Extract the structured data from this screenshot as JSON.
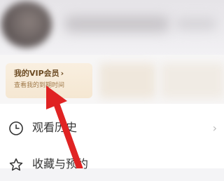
{
  "vip_card": {
    "title": "我的VIP会员",
    "chevron": "›",
    "subtitle": "查看我的到期时间"
  },
  "menu": {
    "items": [
      {
        "label": "观看历史",
        "icon": "clock-icon"
      },
      {
        "label": "收藏与预约",
        "icon": "star-icon"
      }
    ]
  },
  "colors": {
    "vip_card_bg": "#f7ebda",
    "vip_text": "#6b4a22",
    "annotation_arrow": "#e02323"
  }
}
